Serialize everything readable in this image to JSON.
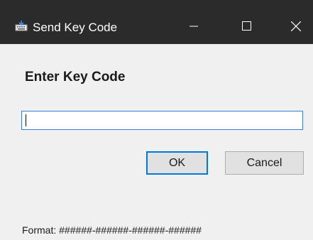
{
  "window": {
    "title": "Send Key Code",
    "icon": "keyboard-app-icon",
    "controls": {
      "minimize": "minimize-icon",
      "maximize": "maximize-icon",
      "close": "close-icon"
    },
    "titlebar_color": "#2b2b2b",
    "accent_color": "#0078d7"
  },
  "dialog": {
    "heading": "Enter Key Code",
    "input": {
      "value": "",
      "placeholder": ""
    },
    "ok_label": "OK",
    "cancel_label": "Cancel",
    "format_text": "Format: ######-######-######-######"
  }
}
